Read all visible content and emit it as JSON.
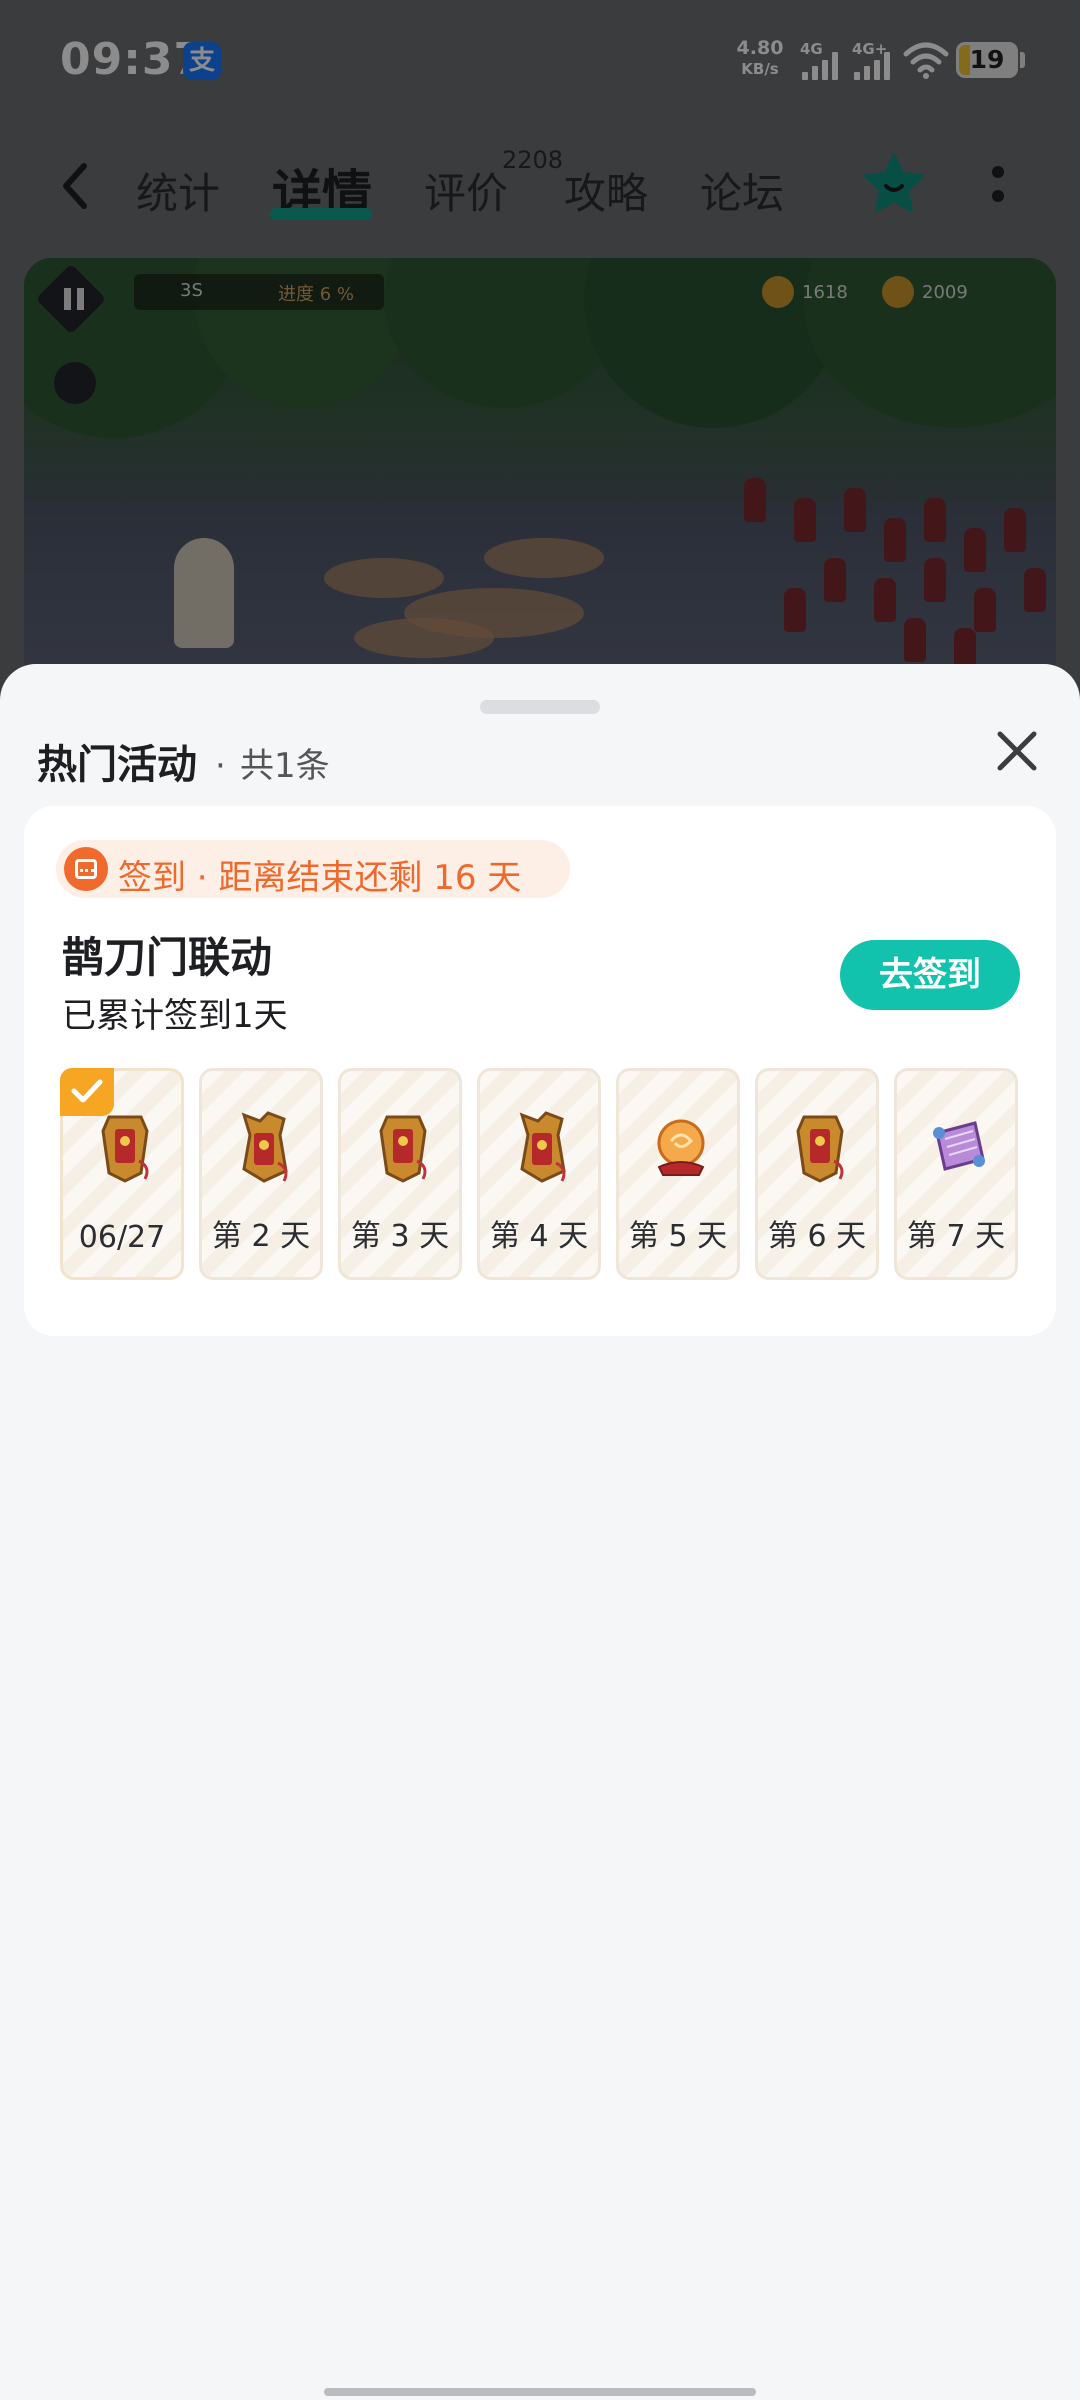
{
  "status_bar": {
    "time": "09:37",
    "alipay_badge": "支",
    "net_speed_value": "4.80",
    "net_speed_unit": "KB/s",
    "signal_1_label": "4G",
    "signal_2_label": "4G+",
    "battery_level": "19"
  },
  "nav": {
    "tabs": [
      {
        "label": "统计"
      },
      {
        "label": "详情"
      },
      {
        "label": "评价"
      },
      {
        "label": "攻略"
      },
      {
        "label": "论坛"
      }
    ],
    "active_tab": "详情",
    "review_count": "2208",
    "accent_color": "#12a58f"
  },
  "video_preview": {
    "timer": "3S",
    "progress_text": "进度 6 %",
    "resource_1": "1618",
    "resource_2": "2009"
  },
  "sheet": {
    "title": "热门活动",
    "dot": "·",
    "count_text": "共1条",
    "card": {
      "tag_text": "签到 · 距离结束还剩 16 天",
      "activity_title": "鹊刀门联动",
      "progress_text": "已累计签到1天",
      "button_label": "去签到",
      "button_color": "#13c2ad",
      "days": [
        {
          "label": "06/27",
          "checked": true,
          "reward_icon": "token-icon"
        },
        {
          "label": "第 2 天",
          "checked": false,
          "reward_icon": "token-icon"
        },
        {
          "label": "第 3 天",
          "checked": false,
          "reward_icon": "token-icon"
        },
        {
          "label": "第 4 天",
          "checked": false,
          "reward_icon": "token-icon"
        },
        {
          "label": "第 5 天",
          "checked": false,
          "reward_icon": "orb-icon"
        },
        {
          "label": "第 6 天",
          "checked": false,
          "reward_icon": "token-icon"
        },
        {
          "label": "第 7 天",
          "checked": false,
          "reward_icon": "scroll-icon"
        }
      ]
    }
  }
}
